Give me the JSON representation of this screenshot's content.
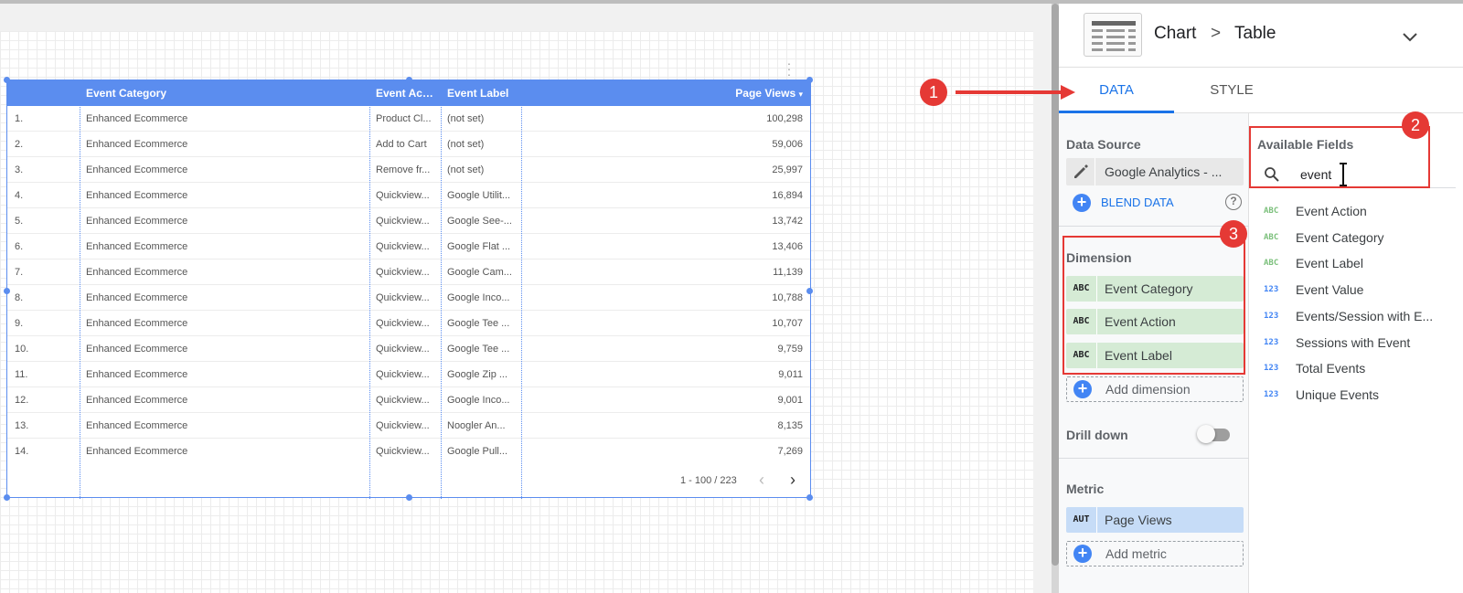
{
  "table": {
    "headers": [
      "",
      "Event Category",
      "Event Action",
      "Event Label",
      "Page Views"
    ],
    "sort_indicator": "▾",
    "rows": [
      [
        "1.",
        "Enhanced Ecommerce",
        "Product Cl...",
        "(not set)",
        "100,298"
      ],
      [
        "2.",
        "Enhanced Ecommerce",
        "Add to Cart",
        "(not set)",
        "59,006"
      ],
      [
        "3.",
        "Enhanced Ecommerce",
        "Remove fr...",
        "(not set)",
        "25,997"
      ],
      [
        "4.",
        "Enhanced Ecommerce",
        "Quickview...",
        "Google Utilit...",
        "16,894"
      ],
      [
        "5.",
        "Enhanced Ecommerce",
        "Quickview...",
        "Google See-...",
        "13,742"
      ],
      [
        "6.",
        "Enhanced Ecommerce",
        "Quickview...",
        "Google Flat ...",
        "13,406"
      ],
      [
        "7.",
        "Enhanced Ecommerce",
        "Quickview...",
        "Google Cam...",
        "11,139"
      ],
      [
        "8.",
        "Enhanced Ecommerce",
        "Quickview...",
        "Google Inco...",
        "10,788"
      ],
      [
        "9.",
        "Enhanced Ecommerce",
        "Quickview...",
        "Google Tee ...",
        "10,707"
      ],
      [
        "10.",
        "Enhanced Ecommerce",
        "Quickview...",
        "Google Tee ...",
        "9,759"
      ],
      [
        "11.",
        "Enhanced Ecommerce",
        "Quickview...",
        "Google Zip ...",
        "9,011"
      ],
      [
        "12.",
        "Enhanced Ecommerce",
        "Quickview...",
        "Google Inco...",
        "9,001"
      ],
      [
        "13.",
        "Enhanced Ecommerce",
        "Quickview...",
        "Noogler An...",
        "8,135"
      ],
      [
        "14.",
        "Enhanced Ecommerce",
        "Quickview...",
        "Google Pull...",
        "7,269"
      ]
    ],
    "pager": "1 - 100 / 223",
    "prev_icon": "‹",
    "next_icon": "›"
  },
  "callouts": [
    "1",
    "2",
    "3"
  ],
  "panel": {
    "breadcrumb_chart": "Chart",
    "breadcrumb_sep": ">",
    "breadcrumb_type": "Table",
    "tabs": [
      {
        "label": "DATA",
        "active": true
      },
      {
        "label": "STYLE",
        "active": false
      }
    ],
    "data_source": {
      "label": "Data Source",
      "value": "Google Analytics - ...",
      "blend_label": "BLEND DATA",
      "help_icon": "?"
    },
    "dimension": {
      "label": "Dimension",
      "chips": [
        {
          "type": "ABC",
          "name": "Event Category"
        },
        {
          "type": "ABC",
          "name": "Event Action"
        },
        {
          "type": "ABC",
          "name": "Event Label"
        }
      ],
      "add_label": "Add dimension"
    },
    "drill_down": {
      "label": "Drill down",
      "enabled": false
    },
    "metric": {
      "label": "Metric",
      "chips": [
        {
          "type": "AUT",
          "name": "Page Views"
        }
      ],
      "add_label": "Add metric"
    },
    "available_fields": {
      "label": "Available Fields",
      "search_value": "event",
      "fields": [
        {
          "type": "ABC",
          "name": "Event Action"
        },
        {
          "type": "ABC",
          "name": "Event Category"
        },
        {
          "type": "ABC",
          "name": "Event Label"
        },
        {
          "type": "123",
          "name": "Event Value"
        },
        {
          "type": "123",
          "name": "Events/Session with E..."
        },
        {
          "type": "123",
          "name": "Sessions with Event"
        },
        {
          "type": "123",
          "name": "Total Events"
        },
        {
          "type": "123",
          "name": "Unique Events"
        }
      ]
    }
  },
  "colors": {
    "accent": "#1a73e8",
    "table_header": "#5b8def",
    "callout": "#e53935",
    "dimension_chip": "#d5ebd5",
    "metric_chip": "#c6dcf7"
  }
}
